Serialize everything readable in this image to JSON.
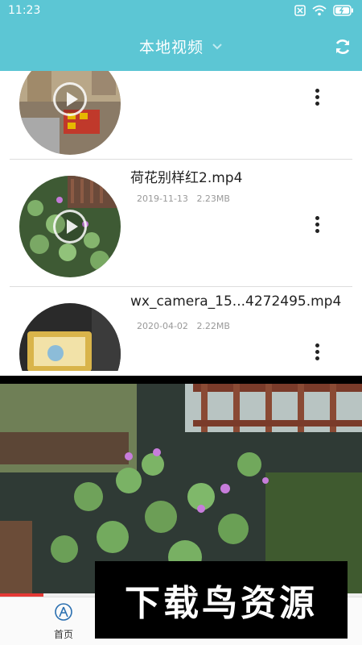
{
  "status_bar": {
    "time": "11:23"
  },
  "app_bar": {
    "title": "本地视频"
  },
  "videos": [
    {
      "name": "",
      "date": "",
      "size": ""
    },
    {
      "name": "荷花别样红2.mp4",
      "date": "2019-11-13",
      "size": "2.23MB"
    },
    {
      "name": "wx_camera_15...4272495.mp4",
      "date": "2020-04-02",
      "size": "2.22MB"
    }
  ],
  "player": {
    "progress": 0.12
  },
  "bottom_nav": {
    "home_label": "首页"
  },
  "watermark": {
    "text": "下载鸟资源"
  },
  "colors": {
    "primary": "#5cc6d4",
    "progress": "#e53935"
  }
}
